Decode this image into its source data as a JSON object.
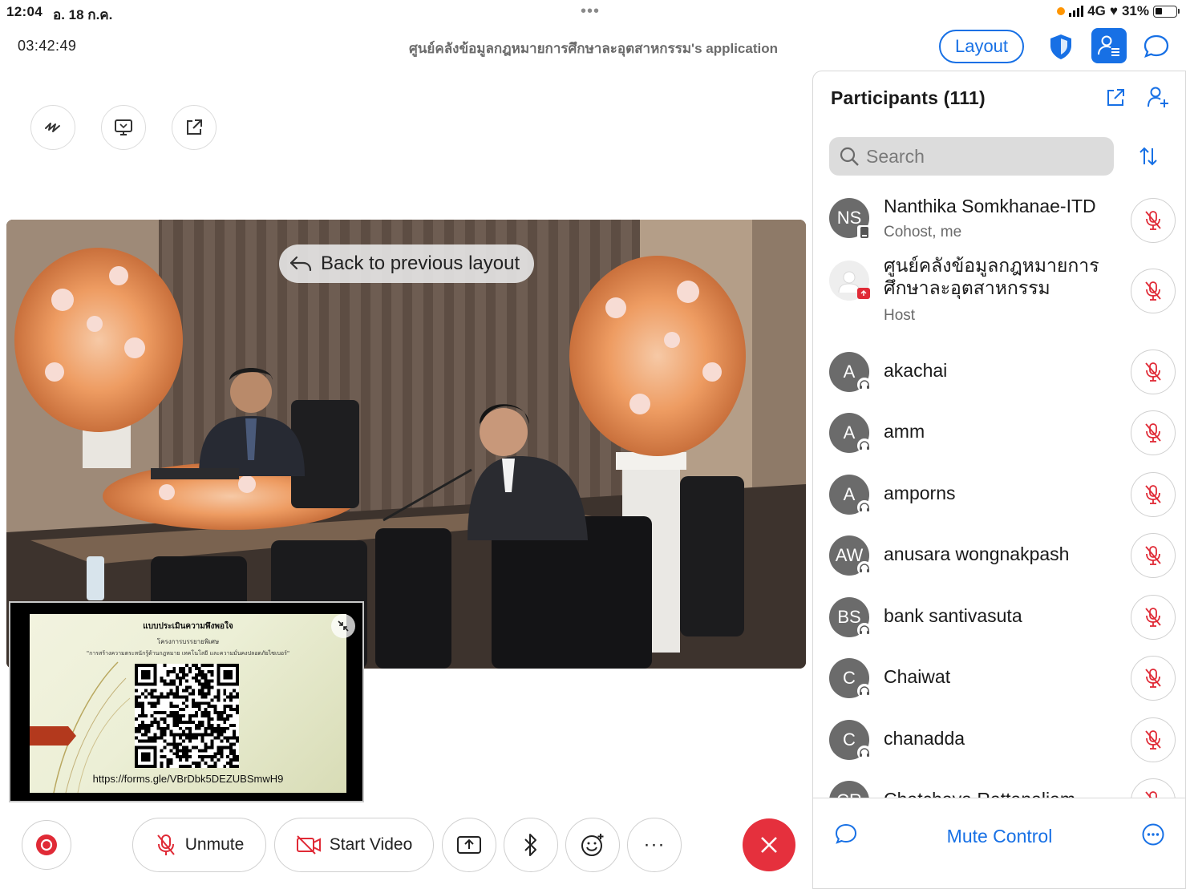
{
  "status_bar": {
    "time": "12:04",
    "date": "อ. 18 ก.ค.",
    "dots": "•••",
    "network": "4G",
    "battery_percent": "31%"
  },
  "header": {
    "timer": "03:42:49",
    "title": "ศูนย์คลังข้อมูลกฎหมายการศึกษาละอุตสาหกรรม's application",
    "layout_label": "Layout"
  },
  "video": {
    "back_to_layout": "Back to previous layout"
  },
  "share": {
    "slide_title": "แบบประเมินความพึงพอใจ",
    "slide_subtitle": "โครงการบรรยายพิเศษ",
    "slide_topic": "\"การสร้างความตระหนักรู้ด้านกฎหมาย เทคโนโลยี และความมั่นคงปลอดภัยไซเบอร์\"",
    "url": "https://forms.gle/VBrDbk5DEZUBSmwH9"
  },
  "controls": {
    "unmute_label": "Unmute",
    "start_video_label": "Start Video",
    "more_label": "···"
  },
  "panel": {
    "title": "Participants (111)",
    "search_placeholder": "Search",
    "participants": [
      {
        "initials": "NS",
        "name": "Nanthika Somkhanae-ITD",
        "role": "Cohost, me"
      },
      {
        "initials": "",
        "name": "ศูนย์คลังข้อมูลกฎหมายการศึกษาละอุตสาหกรรม",
        "role": "Host"
      },
      {
        "initials": "A",
        "name": "akachai",
        "role": ""
      },
      {
        "initials": "A",
        "name": "amm",
        "role": ""
      },
      {
        "initials": "A",
        "name": "amporns",
        "role": ""
      },
      {
        "initials": "AW",
        "name": "anusara wongnakpash",
        "role": ""
      },
      {
        "initials": "BS",
        "name": "bank santivasuta",
        "role": ""
      },
      {
        "initials": "C",
        "name": "Chaiwat",
        "role": ""
      },
      {
        "initials": "C",
        "name": "chanadda",
        "role": ""
      },
      {
        "initials": "CR",
        "name": "Chatchaya Rattanaliam",
        "role": ""
      }
    ],
    "host_name_line1": "ศูนย์คลังข้อมูลกฎหมายการ",
    "host_name_line2": "ศึกษาละอุตสาหกรรม",
    "mute_control_label": "Mute Control"
  },
  "colors": {
    "accent": "#1770e5",
    "end_call": "#e5303d",
    "mute_red": "#e02a36",
    "record_red": "#e02a36"
  }
}
